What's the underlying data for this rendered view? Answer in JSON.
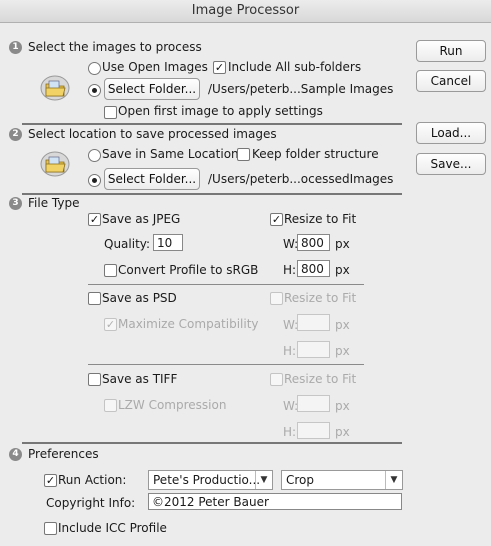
{
  "window": {
    "title": "Image Processor"
  },
  "section1": {
    "number": "1",
    "heading": "Select the images to process",
    "use_open_images": "Use Open Images",
    "include_subfolders": "Include All sub-folders",
    "select_folder_button": "Select Folder...",
    "source_path": "/Users/peterb...Sample Images",
    "open_first_image": "Open first image to apply settings"
  },
  "section2": {
    "number": "2",
    "heading": "Select location to save processed images",
    "save_same_location": "Save in Same Location",
    "keep_folder_structure": "Keep folder structure",
    "select_folder_button": "Select Folder...",
    "dest_path": "/Users/peterb...ocessedImages"
  },
  "section3": {
    "number": "3",
    "heading": "File Type",
    "jpeg": {
      "save_label": "Save as JPEG",
      "resize_label": "Resize to Fit",
      "quality_label": "Quality:",
      "quality_value": "10",
      "w_label": "W:",
      "w_value": "800",
      "w_unit": "px",
      "h_label": "H:",
      "h_value": "800",
      "h_unit": "px",
      "convert_profile": "Convert Profile to sRGB"
    },
    "psd": {
      "save_label": "Save as PSD",
      "resize_label": "Resize to Fit",
      "maximize": "Maximize Compatibility",
      "w_label": "W:",
      "w_unit": "px",
      "h_label": "H:",
      "h_unit": "px"
    },
    "tiff": {
      "save_label": "Save as TIFF",
      "resize_label": "Resize to Fit",
      "lzw": "LZW Compression",
      "w_label": "W:",
      "w_unit": "px",
      "h_label": "H:",
      "h_unit": "px"
    }
  },
  "section4": {
    "number": "4",
    "heading": "Preferences",
    "run_action_label": "Run Action:",
    "action_set": "Pete's Productio...",
    "action_name": "Crop",
    "copyright_label": "Copyright Info:",
    "copyright_value": "©2012 Peter Bauer",
    "include_icc": "Include ICC Profile"
  },
  "buttons": {
    "run": "Run",
    "cancel": "Cancel",
    "load": "Load...",
    "save": "Save..."
  },
  "checkmark": "✓"
}
